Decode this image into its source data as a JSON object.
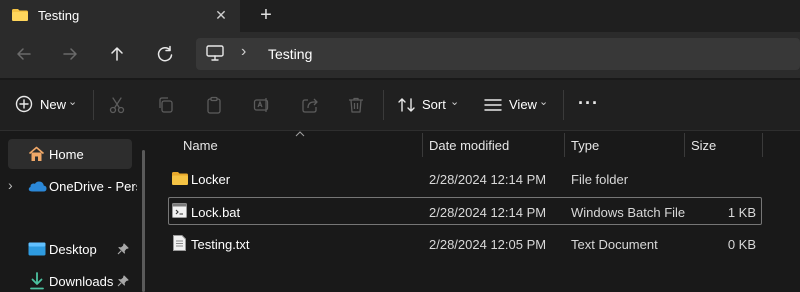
{
  "tab": {
    "title": "Testing",
    "close_glyph": "✕",
    "new_tab_glyph": "+"
  },
  "address": {
    "path": "Testing",
    "sep": "›"
  },
  "toolbar": {
    "new_label": "New",
    "sort_label": "Sort",
    "view_label": "View",
    "more_glyph": "···",
    "chevron": "⌄"
  },
  "sidebar": {
    "items": [
      {
        "label": "Home"
      },
      {
        "label": "OneDrive - Perso"
      },
      {
        "label": "Desktop"
      },
      {
        "label": "Downloads"
      }
    ],
    "expand_glyph": "›"
  },
  "columns": [
    "Name",
    "Date modified",
    "Type",
    "Size"
  ],
  "files": [
    {
      "name": "Locker",
      "date": "2/28/2024 12:14 PM",
      "type": "File folder",
      "size": "",
      "icon": "folder-icon"
    },
    {
      "name": "Lock.bat",
      "date": "2/28/2024 12:14 PM",
      "type": "Windows Batch File",
      "size": "1 KB",
      "icon": "batch-file-icon",
      "selected": true
    },
    {
      "name": "Testing.txt",
      "date": "2/28/2024 12:05 PM",
      "type": "Text Document",
      "size": "0 KB",
      "icon": "text-file-icon"
    }
  ],
  "colors": {
    "folder": "#f5c344",
    "accent": "#4cc2ff",
    "onedrive": "#2b88d8",
    "home": "#f0a868"
  }
}
